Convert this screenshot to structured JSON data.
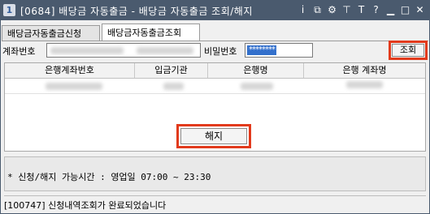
{
  "window": {
    "title_number": "1",
    "title": "[0684] 배당금 자동출금 - 배당금 자동출금 조회/해지",
    "title_icons": [
      "i-icon",
      "restore-icon",
      "settings-icon",
      "pin-icon",
      "help-icon",
      "link-icon",
      "minimize-icon",
      "maximize-icon",
      "close-icon"
    ],
    "title_icon_glyphs": [
      "i",
      "⧉",
      "⚙",
      "⊤",
      "T",
      "?",
      "·",
      "▫",
      "✕"
    ]
  },
  "tabs": [
    {
      "label": "배당금자동출금신청",
      "selected": false
    },
    {
      "label": "배당금자동출금조회",
      "selected": true
    }
  ],
  "form": {
    "account_label": "계좌번호",
    "password_label": "비밀번호",
    "password_value": "********",
    "search_button": "조회"
  },
  "table": {
    "headers": [
      "은행계좌번호",
      "입금기관",
      "은행명",
      "은행 계좌명"
    ]
  },
  "cancel_button": "해지",
  "notice": "* 신청/해지 가능시간 : 영업일 07:00 ~ 23:30",
  "status": "[100747] 신청내역조회가 완료되었습니다",
  "colors": {
    "titlebar": "#4a5a6e",
    "highlight": "#e23a1c",
    "selection": "#3370cc"
  }
}
